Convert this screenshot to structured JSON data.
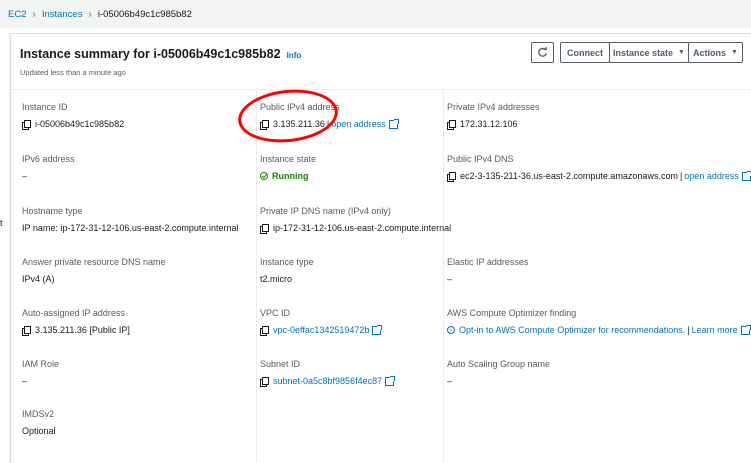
{
  "breadcrumb": {
    "root": "EC2",
    "section": "Instances",
    "current": "i-05006b49c1c985b82"
  },
  "header": {
    "title": "Instance summary for i-05006b49c1c985b82",
    "info": "Info",
    "updated": "Updated less than a minute ago",
    "connect": "Connect",
    "instance_state": "Instance state",
    "actions": "Actions"
  },
  "fields": {
    "instance_id": {
      "label": "Instance ID",
      "value": "i-05006b49c1c985b82"
    },
    "public_ipv4": {
      "label": "Public IPv4 address",
      "value": "3.135.211.36",
      "sep": "|",
      "link": "open address"
    },
    "private_ipv4": {
      "label": "Private IPv4 addresses",
      "value": "172.31.12.106"
    },
    "ipv6": {
      "label": "IPv6 address",
      "value": "–"
    },
    "instance_state": {
      "label": "Instance state",
      "value": "Running"
    },
    "public_dns": {
      "label": "Public IPv4 DNS",
      "value": "ec2-3-135-211-36.us-east-2.compute.amazonaws.com",
      "sep": "|",
      "link": "open address"
    },
    "hostname_type": {
      "label": "Hostname type",
      "value": "IP name: ip-172-31-12-106.us-east-2.compute.internal"
    },
    "private_dns": {
      "label": "Private IP DNS name (IPv4 only)",
      "value": "ip-172-31-12-106.us-east-2.compute.internal"
    },
    "answer_dns": {
      "label": "Answer private resource DNS name",
      "value": "IPv4 (A)"
    },
    "instance_type": {
      "label": "Instance type",
      "value": "t2.micro"
    },
    "elastic_ip": {
      "label": "Elastic IP addresses",
      "value": "–"
    },
    "auto_ip": {
      "label": "Auto-assigned IP address",
      "value": "3.135.211.36 [Public IP]"
    },
    "vpc_id": {
      "label": "VPC ID",
      "value": "vpc-0effac1342519472b"
    },
    "optimizer": {
      "label": "AWS Compute Optimizer finding",
      "value": "Opt-in to AWS Compute Optimizer for recommendations.",
      "sep": "|",
      "link": "Learn more"
    },
    "iam_role": {
      "label": "IAM Role",
      "value": "–"
    },
    "subnet_id": {
      "label": "Subnet ID",
      "value": "subnet-0a5c8bf9856f4ec87"
    },
    "asg_name": {
      "label": "Auto Scaling Group name",
      "value": "–"
    },
    "imdsv2": {
      "label": "IMDSv2",
      "value": "Optional"
    }
  },
  "side_tick": "t",
  "colors": {
    "link": "#0073bb",
    "running": "#1d8102",
    "annotation": "#ff0000"
  }
}
